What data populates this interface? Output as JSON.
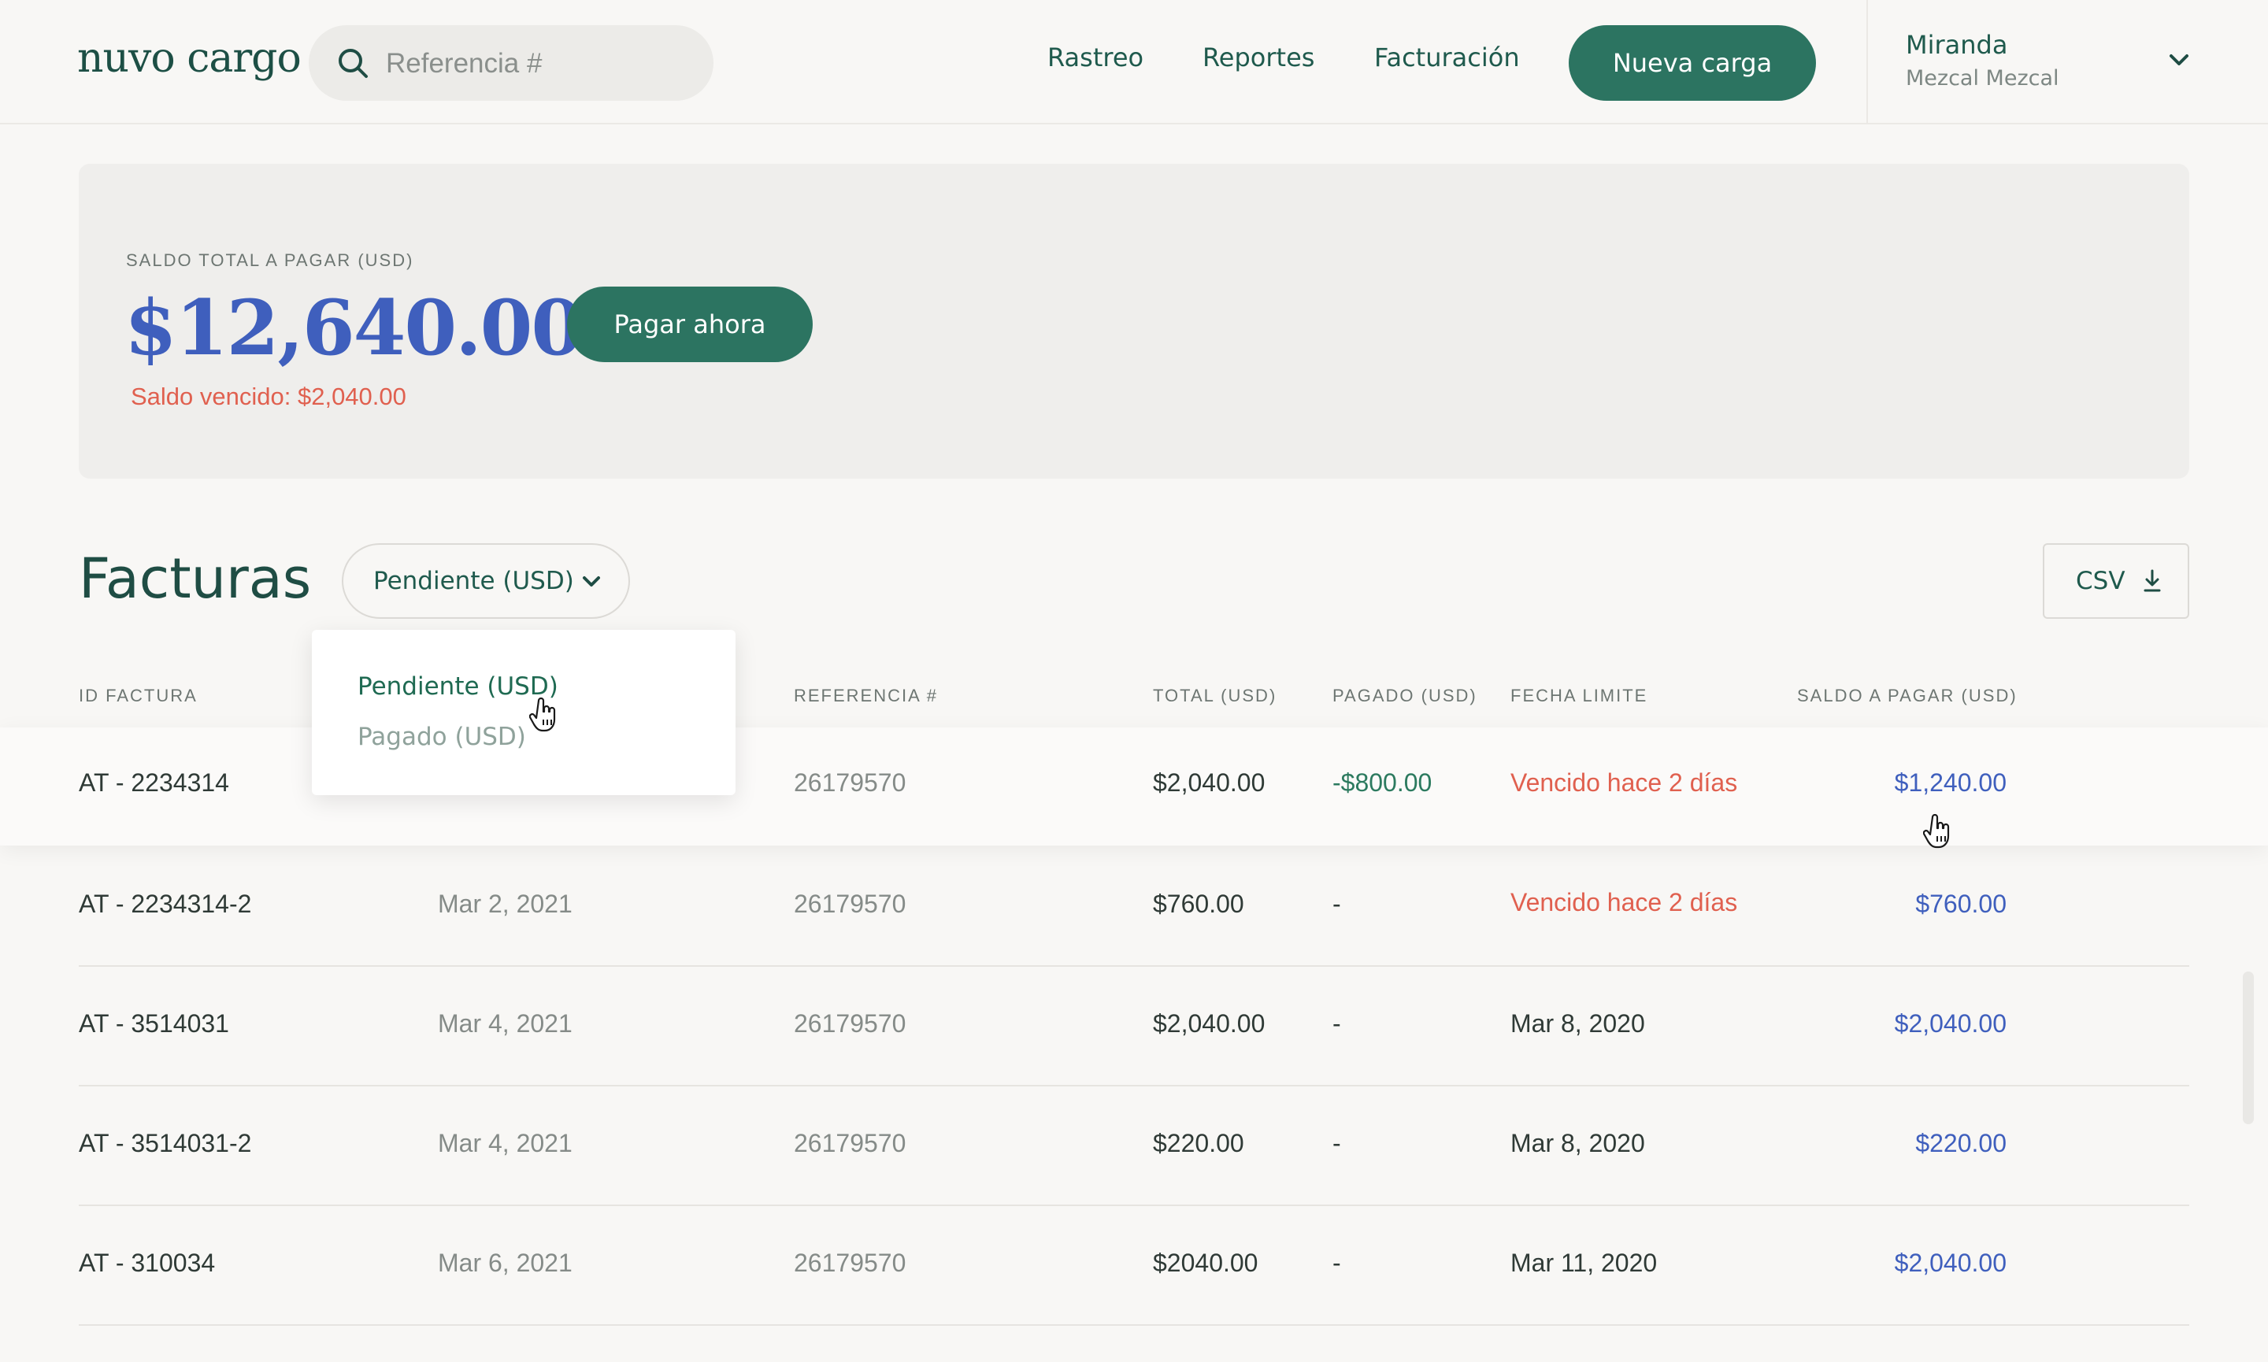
{
  "header": {
    "logo": "nuvo cargo",
    "search_placeholder": "Referencia #",
    "nav": [
      "Rastreo",
      "Reportes",
      "Facturación"
    ],
    "new_button": "Nueva carga",
    "user": {
      "name": "Miranda",
      "company": "Mezcal Mezcal"
    }
  },
  "summary": {
    "label": "SALDO TOTAL A PAGAR (USD)",
    "amount": "$12,640.00",
    "overdue": "Saldo vencido: $2,040.00",
    "pay_button": "Pagar ahora"
  },
  "invoices": {
    "title": "Facturas",
    "filter_selected": "Pendiente (USD)",
    "filter_options": [
      "Pendiente (USD)",
      "Pagado (USD)"
    ],
    "csv_label": "CSV",
    "columns": [
      "ID FACTURA",
      "REFERENCIA #",
      "TOTAL (USD)",
      "PAGADO (USD)",
      "FECHA LIMITE",
      "SALDO A PAGAR (USD)"
    ],
    "rows": [
      {
        "id": "AT - 2234314",
        "date": "",
        "ref": "26179570",
        "total": "$2,040.00",
        "paid": "-$800.00",
        "due": "Vencido hace 2 días",
        "balance": "$1,240.00"
      },
      {
        "id": "AT - 2234314-2",
        "date": "Mar 2, 2021",
        "ref": "26179570",
        "total": "$760.00",
        "paid": "-",
        "due": "Vencido hace 2 días",
        "balance": "$760.00"
      },
      {
        "id": "AT - 3514031",
        "date": "Mar 4, 2021",
        "ref": "26179570",
        "total": "$2,040.00",
        "paid": "-",
        "due": "Mar 8, 2020",
        "balance": "$2,040.00"
      },
      {
        "id": "AT - 3514031-2",
        "date": "Mar 4, 2021",
        "ref": "26179570",
        "total": "$220.00",
        "paid": "-",
        "due": "Mar 8, 2020",
        "balance": "$220.00"
      },
      {
        "id": "AT - 310034",
        "date": "Mar 6, 2021",
        "ref": "26179570",
        "total": "$2040.00",
        "paid": "-",
        "due": "Mar 11, 2020",
        "balance": "$2,040.00"
      }
    ]
  },
  "colors": {
    "brand_green": "#2c7461",
    "accent_blue": "#3f5fbd",
    "overdue_red": "#e0604f",
    "paid_green": "#2c7a5f"
  },
  "icons": [
    "search-icon",
    "chevron-down-icon",
    "download-icon",
    "hand-cursor-icon"
  ]
}
